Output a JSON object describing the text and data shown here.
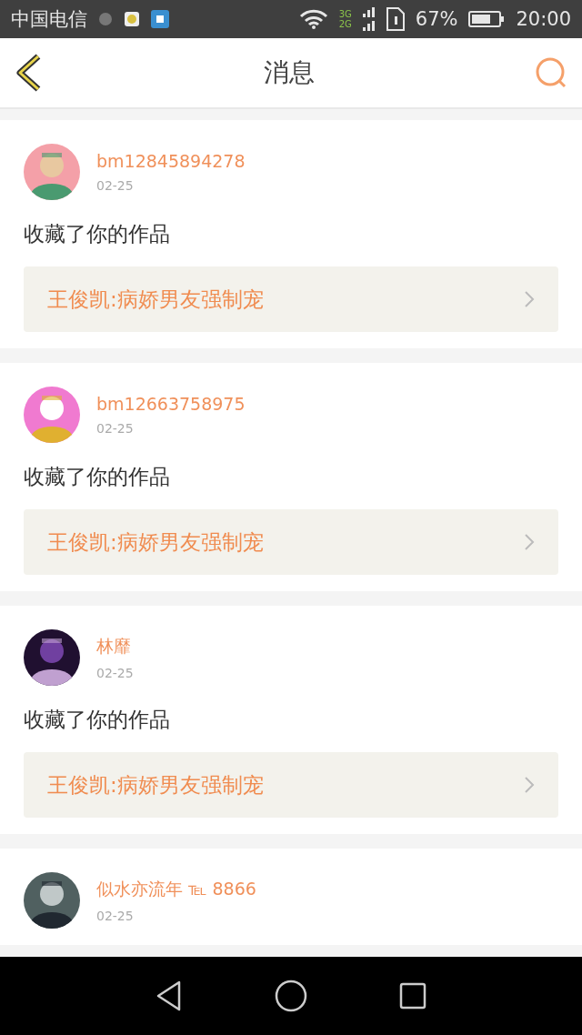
{
  "status_bar": {
    "carrier": "中国电信",
    "network_top": "3G",
    "network_bottom": "2G",
    "battery": "67%",
    "time": "20:00"
  },
  "header": {
    "title": "消息"
  },
  "messages": [
    {
      "user": "bm12845894278",
      "date": "02-25",
      "action": "收藏了你的作品",
      "work": "王俊凯:病娇男友强制宠"
    },
    {
      "user": "bm12663758975",
      "date": "02-25",
      "action": "收藏了你的作品",
      "work": "王俊凯:病娇男友强制宠"
    },
    {
      "user": "林靡",
      "date": "02-25",
      "action": "收藏了你的作品",
      "work": "王俊凯:病娇男友强制宠"
    },
    {
      "user": "似水亦流年 ℡ 8866",
      "date": "02-25"
    }
  ]
}
